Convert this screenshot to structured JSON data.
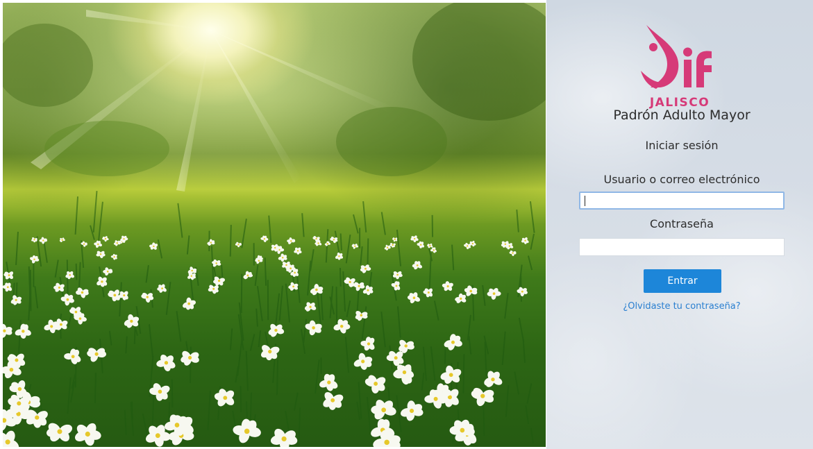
{
  "brand": {
    "logo_mark": "dif",
    "subtitle": "JALISCO",
    "app_title": "Padrón Adulto Mayor",
    "color": "#d63a78"
  },
  "login": {
    "heading": "Iniciar sesión",
    "user_label": "Usuario o correo electrónico",
    "user_value": "",
    "password_label": "Contraseña",
    "password_value": "",
    "submit_label": "Entrar",
    "forgot_link": "¿Olvidaste tu contraseña?",
    "accent_color": "#1d86d9"
  },
  "background_image": {
    "description_icon": "meadow-flowers-sunlight-photo"
  }
}
